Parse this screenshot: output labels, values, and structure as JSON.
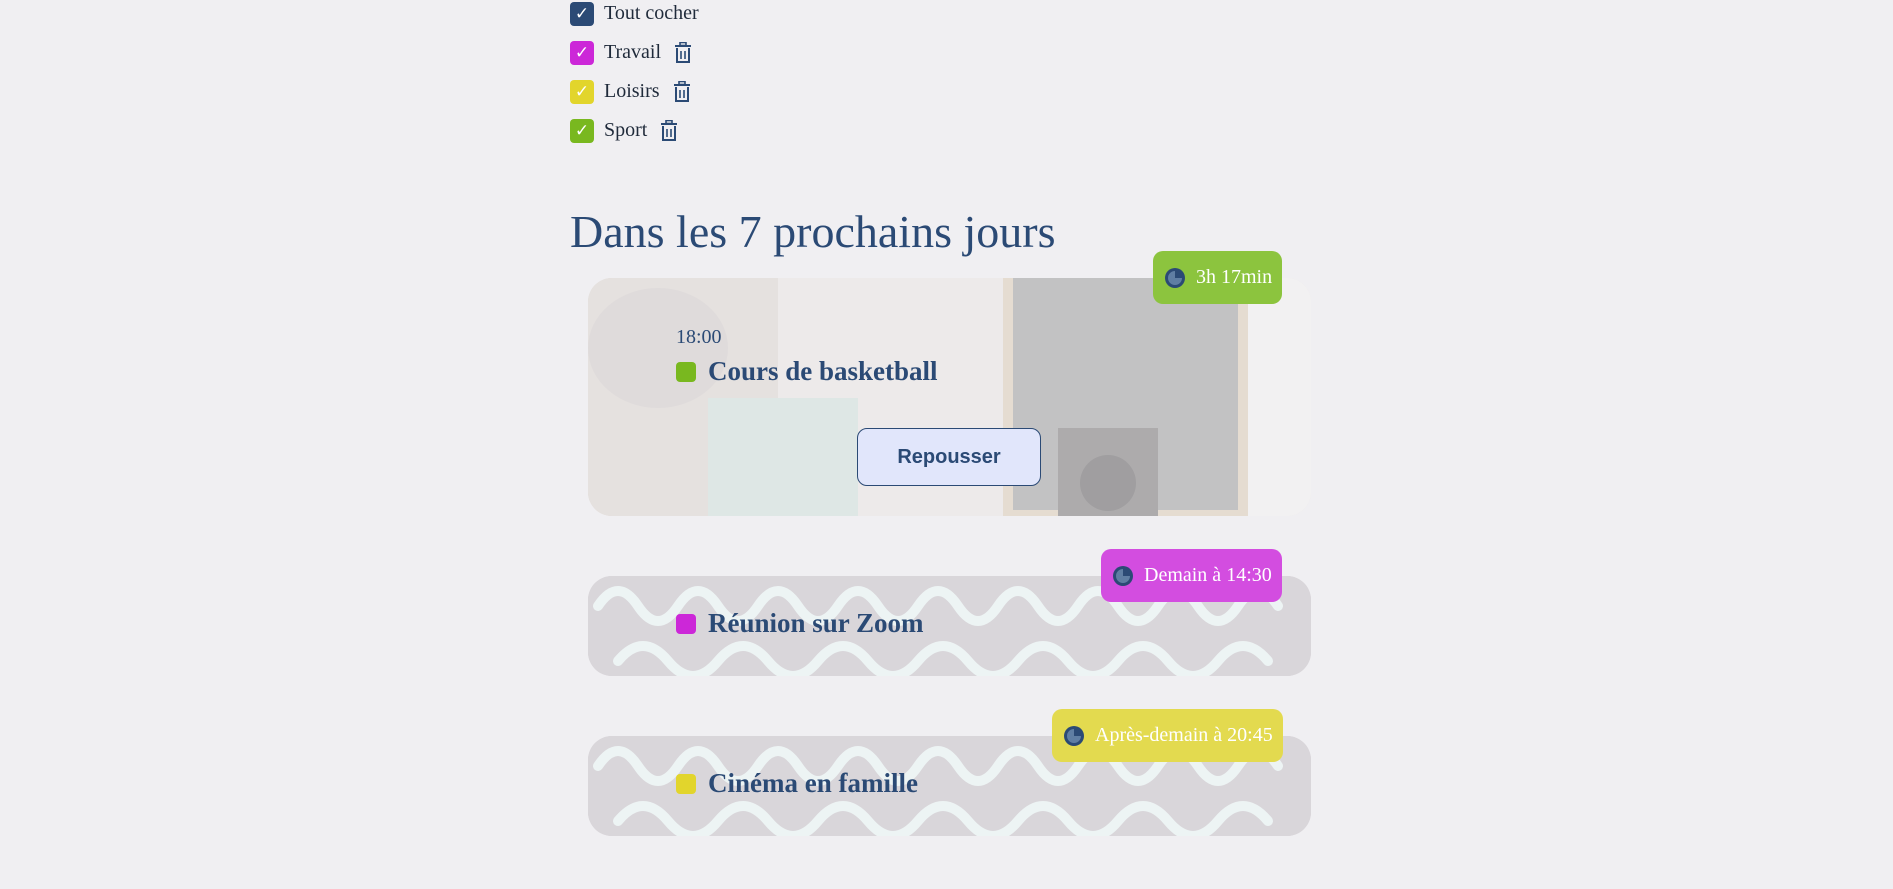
{
  "categories": {
    "toggle_all": {
      "label": "Tout cocher",
      "color": "#2b4a75",
      "check": "✓"
    },
    "items": [
      {
        "label": "Travail",
        "color": "#cc27d8",
        "check": "✓"
      },
      {
        "label": "Loisirs",
        "color": "#e2d52c",
        "check": "✓"
      },
      {
        "label": "Sport",
        "color": "#79b81f",
        "check": "✓"
      }
    ]
  },
  "section": {
    "title": "Dans les 7 prochains jours"
  },
  "events": [
    {
      "time": "18:00",
      "title": "Cours de basketball",
      "category_color": "#79b81f",
      "badge": {
        "text": "3h 17min",
        "color": "#8cc43e"
      },
      "postpone_label": "Repousser"
    },
    {
      "title": "Réunion sur Zoom",
      "category_color": "#cc27d8",
      "badge": {
        "text": "Demain à 14:30",
        "color": "#d34de0"
      }
    },
    {
      "title": "Cinéma en famille",
      "category_color": "#e2d52c",
      "badge": {
        "text": "Après-demain à 20:45",
        "color": "#e3da4f"
      }
    }
  ]
}
